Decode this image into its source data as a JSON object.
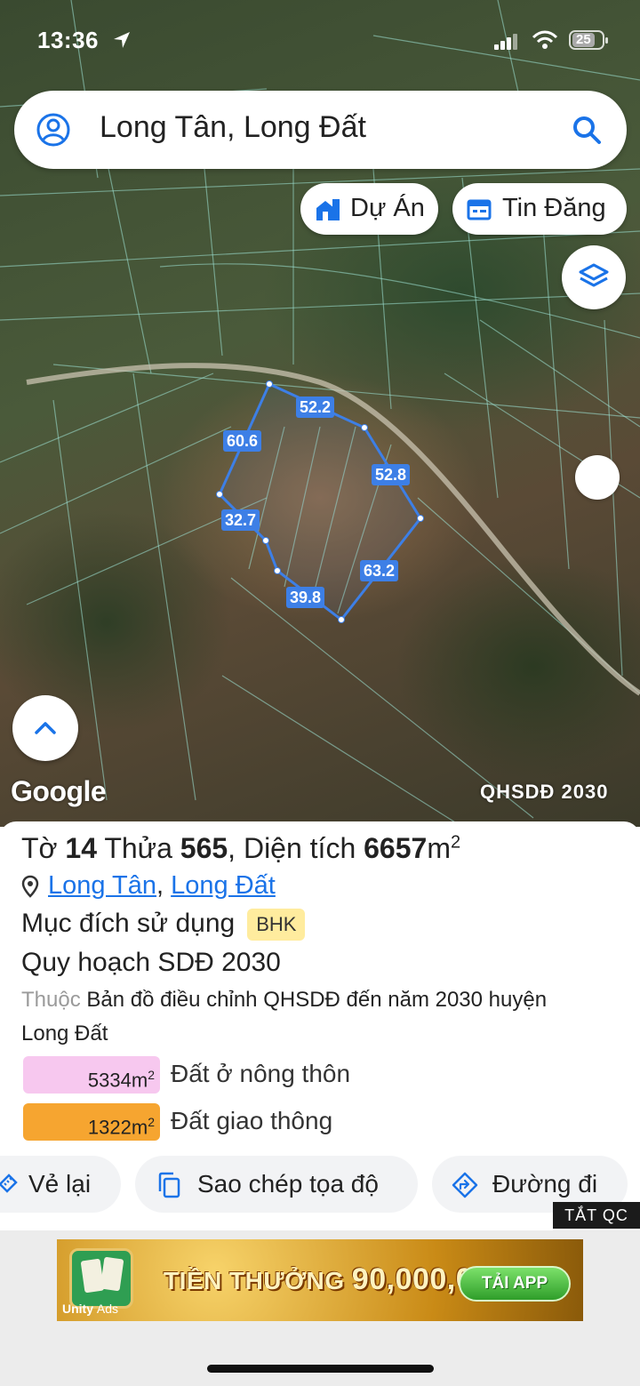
{
  "status_bar": {
    "time": "13:36",
    "battery": "25"
  },
  "search": {
    "query": "Long Tân, Long Đất"
  },
  "chips": {
    "projects_label": "Dự Án",
    "listings_label": "Tin Đăng"
  },
  "map": {
    "google_label": "Google",
    "layer_label": "QHSDĐ 2030",
    "parcel_edges": [
      "60.6",
      "52.2",
      "52.8",
      "63.2",
      "39.8",
      "32.7"
    ]
  },
  "parcel": {
    "title_prefix": "Tờ",
    "sheet_number": "14",
    "lot_label": "Thửa",
    "lot_number": "565",
    "area_label": ", Diện tích",
    "area_value": "6657",
    "area_unit": "m",
    "area_sup": "2",
    "commune": "Long Tân",
    "district": "Long Đất",
    "purpose_label": "Mục đích sử dụng",
    "purpose_code": "BHK",
    "plan_title": "Quy hoạch SDĐ 2030",
    "belongs_label": "Thuộc",
    "plan_desc": "Bản đồ điều chỉnh QHSDĐ đến năm 2030 huyện Long Đất",
    "uses": [
      {
        "area": "5334m",
        "sup": "2",
        "name": "Đất ở nông thôn",
        "color": "#f7c8ef"
      },
      {
        "area": "1322m",
        "sup": "2",
        "name": "Đất giao thông",
        "color": "#f6a530"
      }
    ]
  },
  "actions": {
    "redraw": "Vẻ lại",
    "copy_coords": "Sao chép tọa độ",
    "directions": "Đường đi"
  },
  "ad": {
    "close_label": "TẮT QC",
    "unity_label": "Unity",
    "ads_label": "Ads",
    "promo_prefix": "TIỀN THƯỞNG",
    "promo_amount": "90,000,000Đ",
    "cta": "TẢI APP"
  },
  "colors": {
    "accent": "#1a73e8",
    "parcel_line": "#3d7fe6"
  }
}
